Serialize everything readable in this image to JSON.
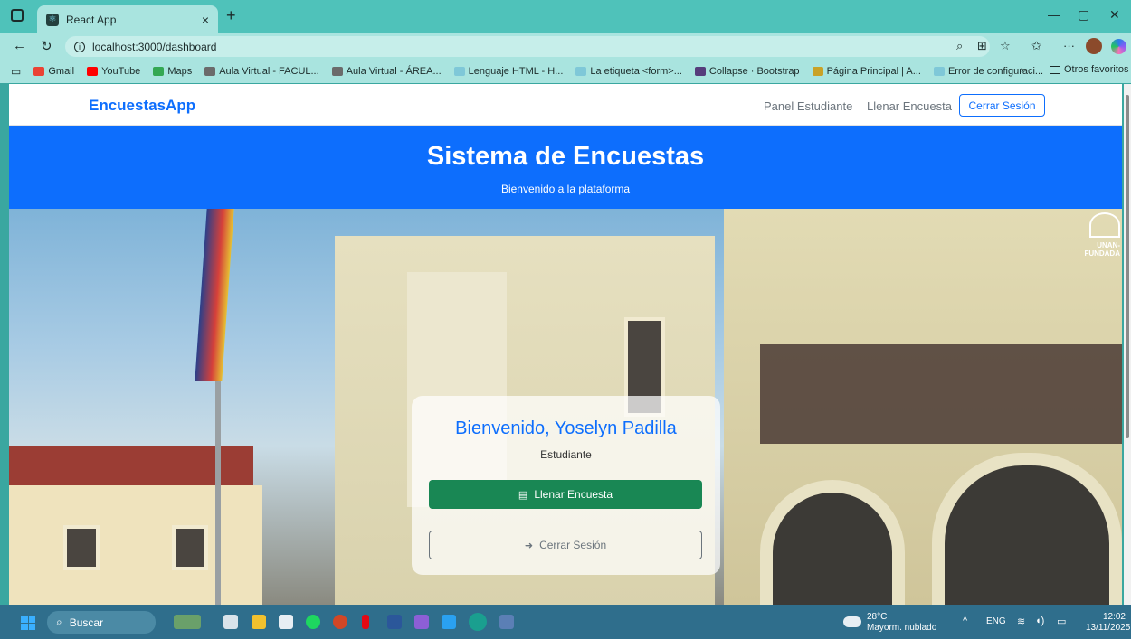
{
  "browser": {
    "tab_title": "React App",
    "url": "localhost:3000/dashboard",
    "bookmarks": [
      {
        "label": "Gmail",
        "color": "#ea4335"
      },
      {
        "label": "YouTube",
        "color": "#ff0000"
      },
      {
        "label": "Maps",
        "color": "#34a853"
      },
      {
        "label": "Aula Virtual - FACUL...",
        "color": "#6b6b6b"
      },
      {
        "label": "Aula Virtual - ÁREA...",
        "color": "#6b6b6b"
      },
      {
        "label": "Lenguaje HTML - H...",
        "color": "#7fc8d8"
      },
      {
        "label": "La etiqueta <form>...",
        "color": "#7fc8d8"
      },
      {
        "label": "Collapse · Bootstrap",
        "color": "#563d7c"
      },
      {
        "label": "Página Principal | A...",
        "color": "#c9a227"
      },
      {
        "label": "Error de configuraci...",
        "color": "#7fc8d8"
      }
    ],
    "other_favorites": "Otros favoritos"
  },
  "app": {
    "brand": "EncuestasApp",
    "nav": {
      "panel": "Panel Estudiante",
      "fill": "Llenar Encuesta",
      "logout": "Cerrar Sesión"
    },
    "hero": {
      "title": "Sistema de Encuestas",
      "subtitle": "Bienvenido a la plataforma"
    },
    "card": {
      "greeting": "Bienvenido, Yoselyn Padilla",
      "role": "Estudiante",
      "fill_button": "Llenar Encuesta",
      "logout_button": "Cerrar Sesión"
    },
    "photo_watermark": "UNAN-\nFUNDADA",
    "colors": {
      "primary": "#0d6efd",
      "success": "#198754",
      "secondary": "#6c757d"
    }
  },
  "taskbar": {
    "search_placeholder": "Buscar",
    "weather_temp": "28°C",
    "weather_desc": "Mayorm. nublado",
    "lang": "ENG",
    "time": "12:02",
    "date": "13/11/2025"
  }
}
